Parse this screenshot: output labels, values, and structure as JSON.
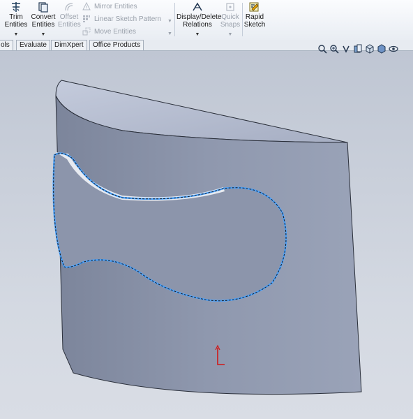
{
  "ribbon": {
    "trim": {
      "line1": "Trim",
      "line2": "Entities",
      "icon": "trim-icon"
    },
    "convert": {
      "line1": "Convert",
      "line2": "Entities",
      "icon": "convert-icon"
    },
    "offset": {
      "line1": "Offset",
      "line2": "Entities",
      "icon": "offset-icon"
    },
    "mirror": {
      "label": "Mirror Entities",
      "icon": "mirror-icon"
    },
    "linear_pattern": {
      "label": "Linear Sketch Pattern",
      "icon": "pattern-icon"
    },
    "move": {
      "label": "Move Entities",
      "icon": "move-icon"
    },
    "display_delete": {
      "line1": "Display/Delete",
      "line2": "Relations",
      "icon": "relations-icon"
    },
    "quick_snaps": {
      "line1": "Quick",
      "line2": "Snaps",
      "icon": "snap-icon"
    },
    "rapid_sketch": {
      "line1": "Rapid",
      "line2": "Sketch",
      "icon": "rapid-sketch-icon"
    }
  },
  "tabs": [
    "ols",
    "Evaluate",
    "DimXpert",
    "Office Products"
  ],
  "view_toolbar": [
    "zoom-to-fit-icon",
    "zoom-area-icon",
    "previous-view-icon",
    "section-view-icon",
    "view-orientation-icon",
    "display-style-icon",
    "hide-show-icon"
  ],
  "colors": {
    "ribbon_bg": "#eef1f5",
    "viewport_bg": "#c9cfd9",
    "face": "#8d96ad",
    "top_face": "#b9c1d4",
    "sketch_highlight": "#4aa3ff",
    "origin": "#d01818"
  }
}
